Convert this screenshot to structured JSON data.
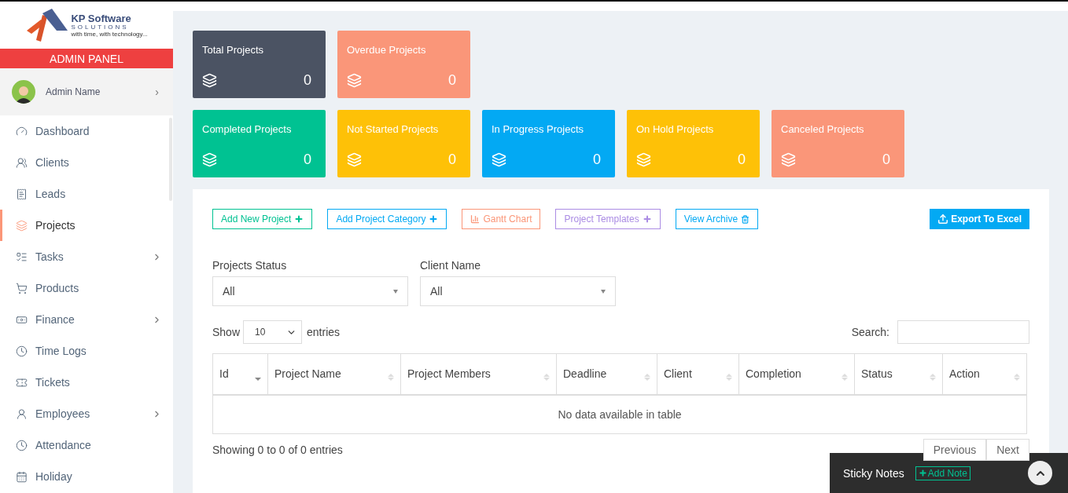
{
  "logo": {
    "name": "KP Software",
    "subtitle": "SOLUTIONS",
    "tagline": "with time, with technology..."
  },
  "sidebar": {
    "panel_title": "ADMIN PANEL",
    "user": {
      "name": "Admin Name",
      "chevron": "›"
    },
    "items": [
      {
        "label": "Dashboard",
        "kind": "dashboard",
        "selected": false,
        "has_children": false
      },
      {
        "label": "Clients",
        "kind": "clients",
        "selected": false,
        "has_children": false
      },
      {
        "label": "Leads",
        "kind": "leads",
        "selected": false,
        "has_children": false
      },
      {
        "label": "Projects",
        "kind": "projects",
        "selected": true,
        "has_children": false
      },
      {
        "label": "Tasks",
        "kind": "tasks",
        "selected": false,
        "has_children": true
      },
      {
        "label": "Products",
        "kind": "products",
        "selected": false,
        "has_children": false
      },
      {
        "label": "Finance",
        "kind": "finance",
        "selected": false,
        "has_children": true
      },
      {
        "label": "Time Logs",
        "kind": "timelogs",
        "selected": false,
        "has_children": false
      },
      {
        "label": "Tickets",
        "kind": "tickets",
        "selected": false,
        "has_children": false
      },
      {
        "label": "Employees",
        "kind": "employees",
        "selected": false,
        "has_children": true
      },
      {
        "label": "Attendance",
        "kind": "attendance",
        "selected": false,
        "has_children": false
      },
      {
        "label": "Holiday",
        "kind": "holiday",
        "selected": false,
        "has_children": false
      }
    ]
  },
  "stat_rows": [
    [
      {
        "title": "Total Projects",
        "value": "0",
        "color": "#4b5363"
      },
      {
        "title": "Overdue Projects",
        "value": "0",
        "color": "#fa9679"
      }
    ],
    [
      {
        "title": "Completed Projects",
        "value": "0",
        "color": "#00c292"
      },
      {
        "title": "Not Started Projects",
        "value": "0",
        "color": "#fec107"
      },
      {
        "title": "In Progress Projects",
        "value": "0",
        "color": "#03a9f3"
      },
      {
        "title": "On Hold Projects",
        "value": "0",
        "color": "#fec107"
      },
      {
        "title": "Canceled Projects",
        "value": "0",
        "color": "#fa9679"
      }
    ]
  ],
  "actions": [
    {
      "label": "Add New Project",
      "kind": "add",
      "color": "#00c292"
    },
    {
      "label": "Add Project Category",
      "kind": "add",
      "color": "#03a9f3"
    },
    {
      "label": "Gantt Chart",
      "kind": "chart",
      "color": "#fb9678"
    },
    {
      "label": "Project Templates",
      "kind": "add",
      "color": "#ab8ce4"
    },
    {
      "label": "View Archive",
      "kind": "archive",
      "color": "#03a9f3"
    }
  ],
  "export_button": {
    "label": "Export To Excel"
  },
  "filters": [
    {
      "label": "Projects Status",
      "value": "All"
    },
    {
      "label": "Client Name",
      "value": "All"
    }
  ],
  "length_control": {
    "before": "Show",
    "value": "10",
    "after": "entries"
  },
  "search": {
    "label": "Search:"
  },
  "table": {
    "columns": [
      {
        "label": "Id",
        "sorted": true
      },
      {
        "label": "Project Name",
        "sorted": false
      },
      {
        "label": "Project Members",
        "sorted": false
      },
      {
        "label": "Deadline",
        "sorted": false
      },
      {
        "label": "Client",
        "sorted": false
      },
      {
        "label": "Completion",
        "sorted": false
      },
      {
        "label": "Status",
        "sorted": false
      },
      {
        "label": "Action",
        "sorted": false
      }
    ],
    "empty_message": "No data available in table"
  },
  "table_info": "Showing 0 to 0 of 0 entries",
  "pagination": [
    "Previous",
    "Next"
  ],
  "sticky_notes": {
    "title": "Sticky Notes",
    "add_label": "Add Note"
  }
}
